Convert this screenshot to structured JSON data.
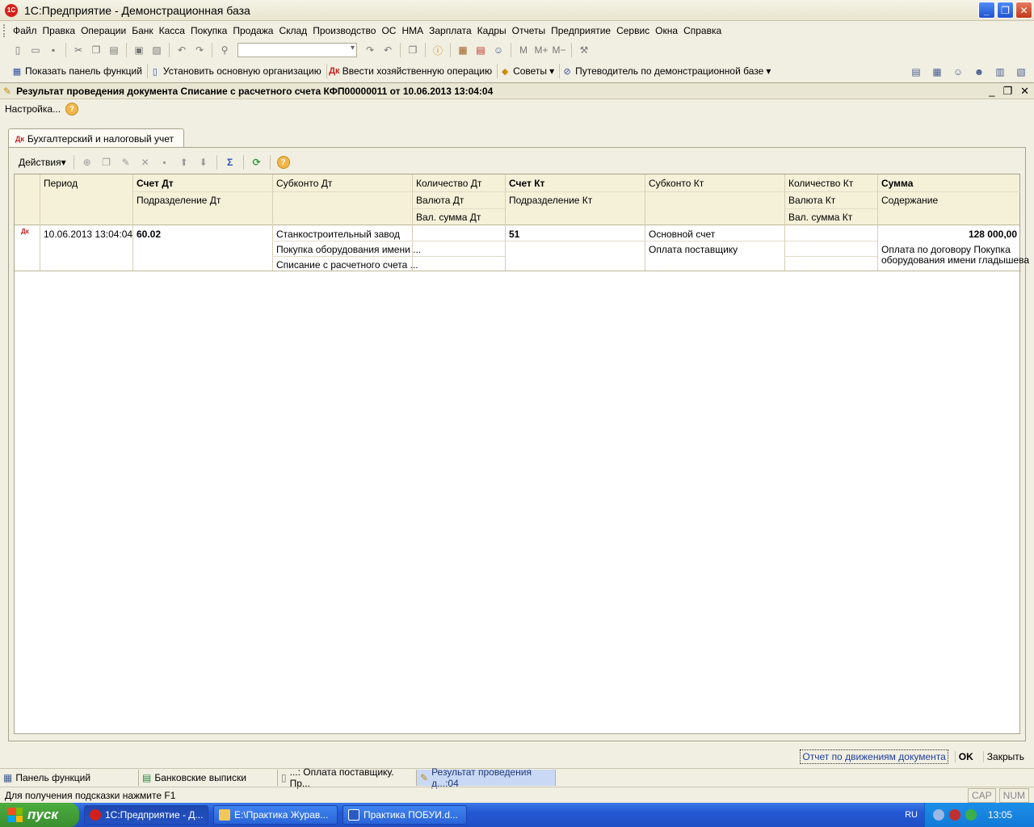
{
  "window": {
    "title": "1С:Предприятие - Демонстрационная база"
  },
  "menu": [
    "Файл",
    "Правка",
    "Операции",
    "Банк",
    "Касса",
    "Покупка",
    "Продажа",
    "Склад",
    "Производство",
    "ОС",
    "НМА",
    "Зарплата",
    "Кадры",
    "Отчеты",
    "Предприятие",
    "Сервис",
    "Окна",
    "Справка"
  ],
  "panel": {
    "show_panel": "Показать панель функций",
    "set_org": "Установить основную организацию",
    "enter_op": "Ввести хозяйственную операцию",
    "tips": "Советы",
    "guide": "Путеводитель по демонстрационной базе"
  },
  "document": {
    "title": "Результат проведения документа Списание с расчетного счета КФП00000011 от 10.06.2013 13:04:04",
    "settings": "Настройка...",
    "tab": "Бухгалтерский и налоговый учет",
    "actions": "Действия"
  },
  "grid": {
    "headers": {
      "period": "Период",
      "dt_account": "Счет Дт",
      "dt_subdivision": "Подразделение Дт",
      "dt_subconto": "Субконто Дт",
      "dt_qty": "Количество Дт",
      "dt_currency": "Валюта Дт",
      "dt_cur_sum": "Вал. сумма Дт",
      "kt_account": "Счет Кт",
      "kt_subdivision": "Подразделение Кт",
      "kt_subconto": "Субконто Кт",
      "kt_qty": "Количество Кт",
      "kt_currency": "Валюта Кт",
      "kt_cur_sum": "Вал. сумма Кт",
      "sum": "Сумма",
      "content": "Содержание"
    },
    "row": {
      "period": "10.06.2013 13:04:04",
      "dt_account": "60.02",
      "dt_subconto1": "Станкостроительный завод",
      "dt_subconto2": "Покупка оборудования имени ...",
      "dt_subconto3": "Списание с расчетного счета ...",
      "kt_account": "51",
      "kt_subconto1": "Основной счет",
      "kt_subconto2": "Оплата поставщику",
      "sum": "128 000,00",
      "content1": "Оплата по договору Покупка",
      "content2": "оборудования имени гладышева"
    }
  },
  "commands": {
    "report": "Отчет по движениям документа",
    "ok": "OK",
    "close": "Закрыть"
  },
  "windows": [
    "Панель функций",
    "Банковские выписки",
    "...: Оплата поставщику. Пр...",
    "Результат проведения д...:04"
  ],
  "status": {
    "hint": "Для получения подсказки нажмите F1",
    "cap": "CAP",
    "num": "NUM"
  },
  "taskbar": {
    "start": "пуск",
    "tasks": [
      "1С:Предприятие - Д...",
      "E:\\Практика Журав...",
      "Практика  ПОБУИ.d..."
    ],
    "lang": "RU",
    "time": "13:05"
  }
}
